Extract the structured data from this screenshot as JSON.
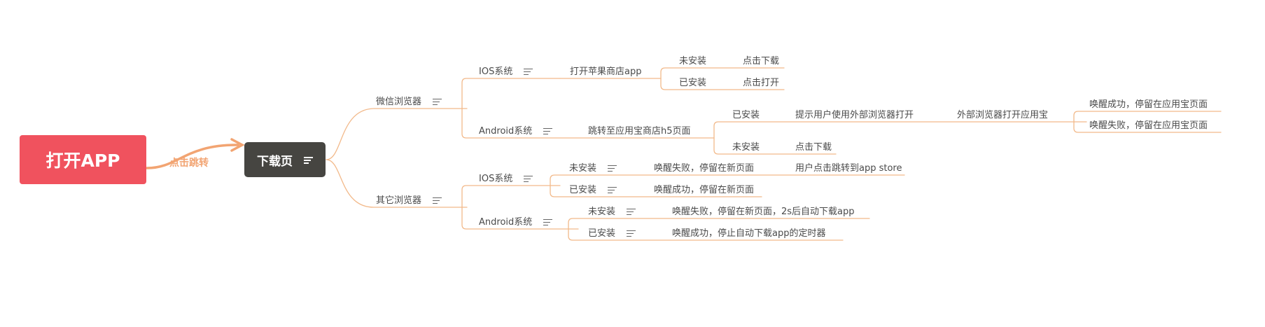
{
  "root": {
    "label": "打开APP"
  },
  "relation": {
    "label": "点击跳转"
  },
  "page": {
    "label": "下载页"
  },
  "wechat": {
    "label": "微信浏览器",
    "ios": {
      "label": "IOS系统",
      "action": "打开苹果商店app",
      "not_installed": {
        "label": "未安装",
        "result": "点击下载"
      },
      "installed": {
        "label": "已安装",
        "result": "点击打开"
      }
    },
    "android": {
      "label": "Android系统",
      "action": "跳转至应用宝商店h5页面",
      "installed": {
        "label": "已安装",
        "prompt": "提示用户使用外部浏览器打开",
        "external": "外部浏览器打开应用宝",
        "success": "唤醒成功，停留在应用宝页面",
        "fail": "唤醒失败，停留在应用宝页面"
      },
      "not_installed": {
        "label": "未安装",
        "result": "点击下载"
      }
    }
  },
  "other": {
    "label": "其它浏览器",
    "ios": {
      "label": "IOS系统",
      "not_installed": {
        "label": "未安装",
        "result": "唤醒失败，停留在新页面",
        "next": "用户点击跳转到app store"
      },
      "installed": {
        "label": "已安装",
        "result": "唤醒成功，停留在新页面"
      }
    },
    "android": {
      "label": "Android系统",
      "not_installed": {
        "label": "未安装",
        "result": "唤醒失败，停留在新页面，2s后自动下载app"
      },
      "installed": {
        "label": "已安装",
        "result": "唤醒成功，停止自动下载app的定时器"
      }
    }
  },
  "colors": {
    "root_fill": "#f0525e",
    "page_fill": "#464541",
    "branch_line": "#f2b98a",
    "arrow": "#f2a472",
    "text": "#4a4a4a"
  }
}
